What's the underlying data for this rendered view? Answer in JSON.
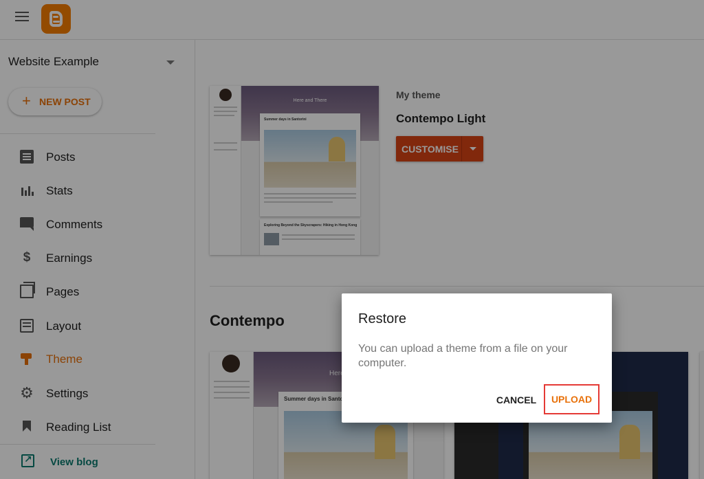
{
  "app": {
    "brand_color": "#f57d00",
    "accent_color": "#e8710a"
  },
  "header": {
    "menu_icon": "hamburger-menu-icon",
    "logo": "blogger-logo"
  },
  "sidebar": {
    "blog_name": "Website Example",
    "new_post_label": "NEW POST",
    "items": [
      {
        "label": "Posts",
        "icon": "posts-icon"
      },
      {
        "label": "Stats",
        "icon": "stats-icon"
      },
      {
        "label": "Comments",
        "icon": "comments-icon"
      },
      {
        "label": "Earnings",
        "icon": "dollar-icon"
      },
      {
        "label": "Pages",
        "icon": "pages-icon"
      },
      {
        "label": "Layout",
        "icon": "layout-icon"
      },
      {
        "label": "Theme",
        "icon": "paint-roller-icon",
        "active": true
      },
      {
        "label": "Settings",
        "icon": "gear-icon"
      },
      {
        "label": "Reading List",
        "icon": "bookmark-icon"
      }
    ],
    "view_blog_label": "View blog"
  },
  "main": {
    "my_theme_label": "My theme",
    "current_theme_name": "Contempo Light",
    "customise_label": "CUSTOMISE",
    "current_thumb": {
      "blog_title": "Here and There",
      "post1_title": "Summer days in Santorini",
      "post2_title": "Exploring Beyond the Skyscrapers: Hiking in Hong Kong"
    },
    "section_title": "Contempo",
    "thumb2": {
      "blog_title": "Here",
      "post_title": "Summer days in Santorini"
    }
  },
  "dialog": {
    "title": "Restore",
    "body": "You can upload a theme from a file on your computer.",
    "cancel_label": "CANCEL",
    "upload_label": "UPLOAD"
  }
}
